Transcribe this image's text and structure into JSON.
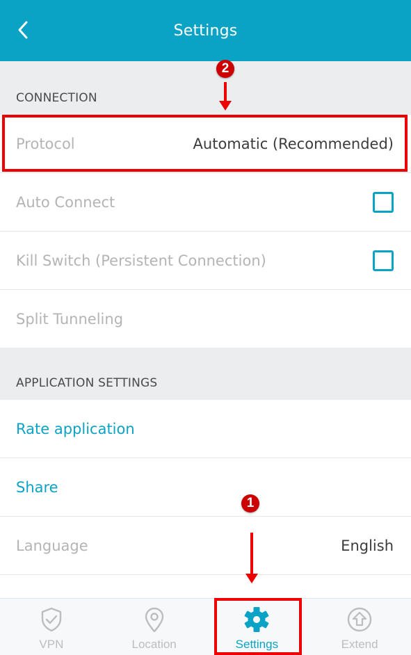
{
  "header": {
    "title": "Settings",
    "back_icon": "chevron-left-icon",
    "background_color": "#0aa3c6"
  },
  "sections": [
    {
      "title": "CONNECTION",
      "rows": [
        {
          "label": "Protocol",
          "value": "Automatic (Recommended)",
          "type": "value"
        },
        {
          "label": "Auto Connect",
          "type": "checkbox",
          "checked": false
        },
        {
          "label": "Kill Switch (Persistent Connection)",
          "type": "checkbox",
          "checked": false
        },
        {
          "label": "Split Tunneling",
          "type": "link"
        }
      ]
    },
    {
      "title": "APPLICATION SETTINGS",
      "rows": [
        {
          "label": "Rate application",
          "type": "action"
        },
        {
          "label": "Share",
          "type": "action"
        },
        {
          "label": "Language",
          "value": "English",
          "type": "value"
        }
      ]
    }
  ],
  "bottom_nav": {
    "items": [
      {
        "label": "VPN",
        "icon": "shield-check-icon",
        "active": false
      },
      {
        "label": "Location",
        "icon": "map-pin-icon",
        "active": false
      },
      {
        "label": "Settings",
        "icon": "gear-icon",
        "active": true
      },
      {
        "label": "Extend",
        "icon": "upload-circle-icon",
        "active": false
      }
    ]
  },
  "annotations": [
    {
      "number": "1",
      "target": "Settings tab"
    },
    {
      "number": "2",
      "target": "Protocol row"
    }
  ],
  "colors": {
    "accent": "#0aa3c6",
    "section_bg": "#ecedef",
    "inactive_text": "#b4b4b4",
    "annotation": "#ee0000"
  }
}
